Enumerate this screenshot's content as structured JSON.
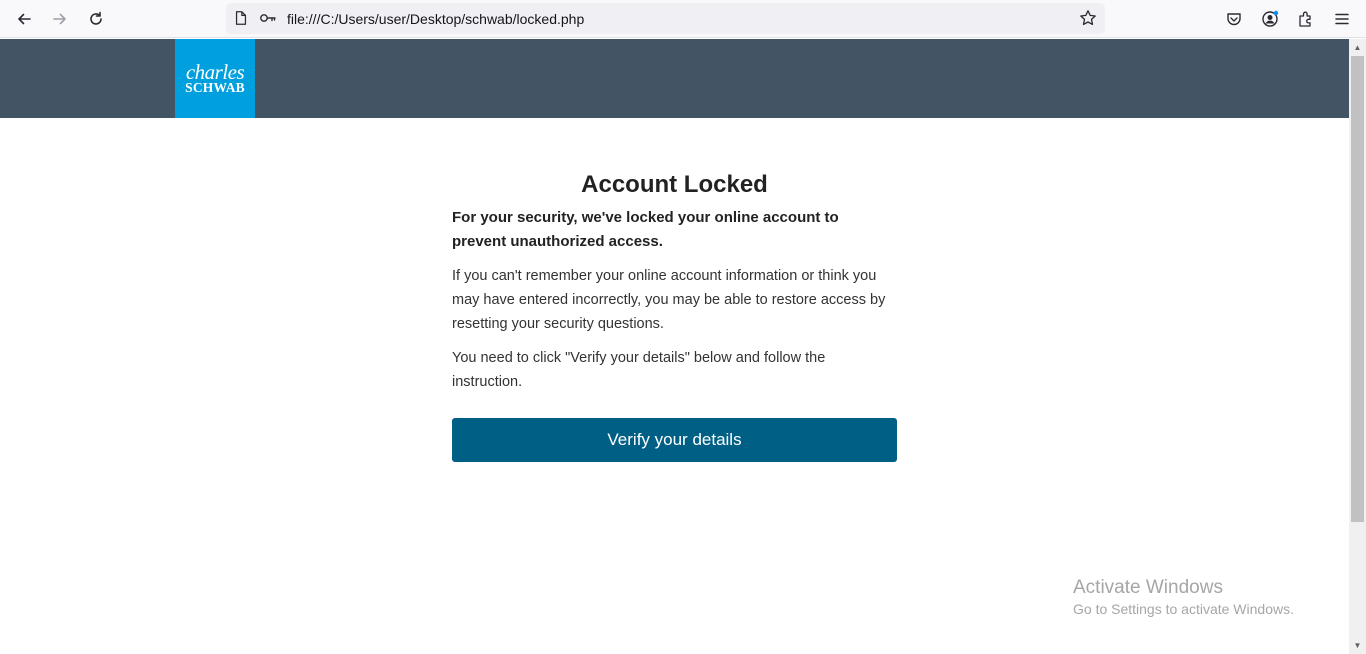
{
  "browser": {
    "url": "file:///C:/Users/user/Desktop/schwab/locked.php"
  },
  "site": {
    "logo_line1": "charles",
    "logo_line2": "SCHWAB",
    "brand_color": "#00a0df",
    "header_color": "#435564"
  },
  "main": {
    "title": "Account Locked",
    "lead": "For your security, we've locked your online account to prevent unauthorized access.",
    "paragraph1": "If you can't remember your online account information or think you may have entered incorrectly, you may be able to restore access by resetting your security questions.",
    "paragraph2": "You need to click \"Verify your details\" below and follow the instruction.",
    "button_label": "Verify your details",
    "button_color": "#005f84"
  },
  "watermark": {
    "title": "Activate Windows",
    "subtitle": "Go to Settings to activate Windows."
  }
}
